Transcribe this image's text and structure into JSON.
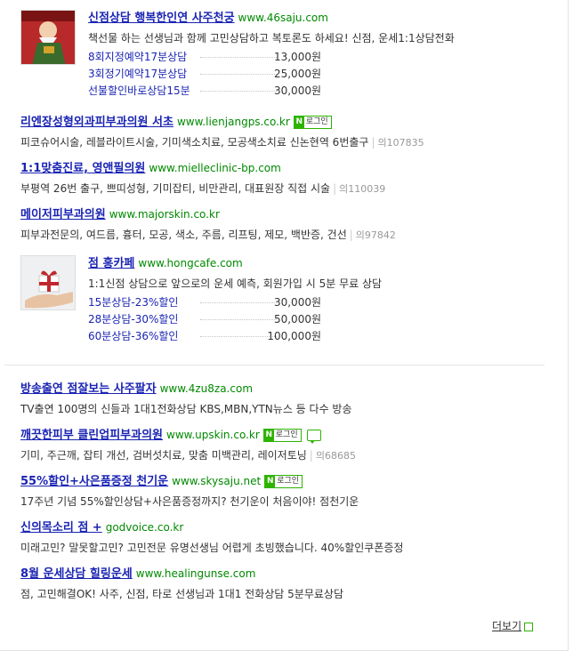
{
  "ads": [
    {
      "title": "신점상담 행복한인연 사주천궁",
      "url": "www.46saju.com",
      "desc": "책선물 하는 선생님과 함께 고민상담하고 복토론도 하세요! 신점, 운세1:1상담전화",
      "prices": [
        {
          "name": "8회지정예약17분상담",
          "value": "13,000원"
        },
        {
          "name": "3회정기예약17분상담",
          "value": "25,000원"
        },
        {
          "name": "선불할인바로상담15분",
          "value": "30,000원"
        }
      ]
    },
    {
      "title": "리엔장성형외과피부과의원 서초",
      "url": "www.lienjangps.co.kr",
      "badge": "로그인",
      "desc": "피코슈어시술, 레블라이트시술, 기미색소치료, 모공색소치료 신논현역 6번출구",
      "sub": "의107835"
    },
    {
      "title": "1:1맞춤진료, 영앤필의원",
      "url": "www.mielleclinic-bp.com",
      "desc": "부평역 26번 출구, 쁘띠성형, 기미잡티, 비만관리, 대표원장 직접 시술",
      "sub": "의110039"
    },
    {
      "title": "메이저피부과의원",
      "url": "www.majorskin.co.kr",
      "desc": "피부과전문의, 여드름, 흉터, 모공, 색소, 주름, 리프팅, 제모, 백반증, 건선",
      "sub": "의97842"
    },
    {
      "title": "점 홍카페",
      "url": "www.hongcafe.com",
      "desc": "1:1신점 상담으로 앞으로의 운세 예측, 회원가입 시 5분 무료 상담",
      "prices": [
        {
          "name": "15분상담-23%할인",
          "value": "30,000원"
        },
        {
          "name": "28분상담-30%할인",
          "value": "50,000원"
        },
        {
          "name": "60분상담-36%할인",
          "value": "100,000원"
        }
      ]
    },
    {
      "title": "방송출연 점잘보는 사주팔자",
      "url": "www.4zu8za.com",
      "desc": "TV출연 100명의 신들과 1대1전화상담 KBS,MBN,YTN뉴스 등 다수 방송"
    },
    {
      "title": "깨끗한피부 클린업피부과의원",
      "url": "www.upskin.co.kr",
      "badge": "로그인",
      "desc": "기미, 주근깨, 잡티 개선, 검버섯치료, 맞춤 미백관리, 레이저토닝",
      "sub": "의68685"
    },
    {
      "title": "55%할인+사은품증정 천기운",
      "url": "www.skysaju.net",
      "badge": "로그인",
      "desc": "17주년 기념 55%할인상담+사은품증정까지? 천기운이 처음이야! 점천기운"
    },
    {
      "title": "신의목소리 점 +",
      "url": "godvoice.co.kr",
      "desc": "미래고민? 말못할고민? 고민전문 유명선생님 어렵게 초빙했습니다. 40%할인쿠폰증정"
    },
    {
      "title": "8월 운세상담 힐링운세",
      "url": "www.healingunse.com",
      "desc": "점, 고민해결OK! 사주, 신점, 타로 선생님과 1대1 전화상담 5분무료상담"
    }
  ],
  "more_label": "더보기",
  "colors": {
    "title": "#1a24b3",
    "url": "#008a00",
    "badge": "#2db400"
  }
}
